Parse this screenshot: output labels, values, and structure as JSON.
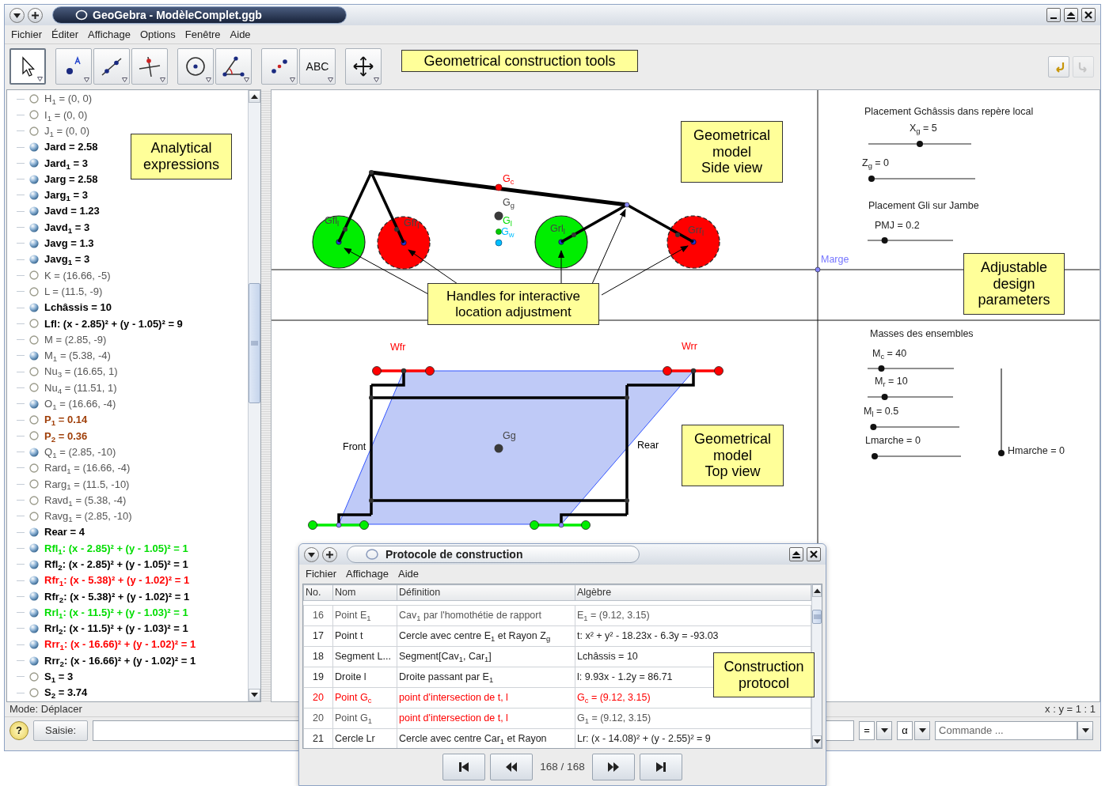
{
  "window": {
    "title": "GeoGebra - ModèleComplet.ggb"
  },
  "menu": [
    "Fichier",
    "Éditer",
    "Affichage",
    "Options",
    "Fenêtre",
    "Aide"
  ],
  "toolbar": {
    "groups": [
      [
        {
          "kind": "move",
          "selected": true
        }
      ],
      [
        {
          "kind": "point",
          "selected": false
        },
        {
          "kind": "line",
          "selected": false
        },
        {
          "kind": "perpendicular",
          "selected": false
        }
      ],
      [
        {
          "kind": "circle",
          "selected": false
        },
        {
          "kind": "angle",
          "selected": false
        }
      ],
      [
        {
          "kind": "reflect",
          "selected": false
        },
        {
          "kind": "text",
          "label": "ABC",
          "selected": false
        }
      ],
      [
        {
          "kind": "pan",
          "selected": false
        }
      ]
    ],
    "undo": {
      "disabled": false
    },
    "redo": {
      "disabled": true
    }
  },
  "annotations": [
    {
      "text": "Geometrical construction tools"
    },
    {
      "text": "Analytical\nexpressions"
    },
    {
      "text": "Geometrical\nmodel\nSide view"
    },
    {
      "text": "Handles for interactive\nlocation adjustment"
    },
    {
      "text": "Adjustable\ndesign\nparameters"
    },
    {
      "text": "Geometrical\nmodel\nTop view"
    },
    {
      "text": "Construction\nprotocol"
    }
  ],
  "algebra": {
    "rows": [
      {
        "text": "H$_{1}$ = (0, 0)",
        "shown": false,
        "bold": false,
        "color": "#555555"
      },
      {
        "text": "I$_{1}$ = (0, 0)",
        "shown": false,
        "bold": false,
        "color": "#555555"
      },
      {
        "text": "J$_{1}$ = (0, 0)",
        "shown": false,
        "bold": false,
        "color": "#555555"
      },
      {
        "text": "Jard = 2.58",
        "shown": true,
        "bold": true,
        "color": "#000000"
      },
      {
        "text": "Jard$_{1}$ = 3",
        "shown": true,
        "bold": true,
        "color": "#000000"
      },
      {
        "text": "Jarg = 2.58",
        "shown": true,
        "bold": true,
        "color": "#000000"
      },
      {
        "text": "Jarg$_{1}$ = 3",
        "shown": true,
        "bold": true,
        "color": "#000000"
      },
      {
        "text": "Javd = 1.23",
        "shown": true,
        "bold": true,
        "color": "#000000"
      },
      {
        "text": "Javd$_{1}$ = 3",
        "shown": true,
        "bold": true,
        "color": "#000000"
      },
      {
        "text": "Javg = 1.3",
        "shown": true,
        "bold": true,
        "color": "#000000"
      },
      {
        "text": "Javg$_{1}$ = 3",
        "shown": true,
        "bold": true,
        "color": "#000000"
      },
      {
        "text": "K = (16.66, -5)",
        "shown": false,
        "bold": false,
        "color": "#555555"
      },
      {
        "text": "L = (11.5, -9)",
        "shown": false,
        "bold": false,
        "color": "#555555"
      },
      {
        "text": "Lchâssis = 10",
        "shown": true,
        "bold": true,
        "color": "#000000"
      },
      {
        "text": "Lfl: (x - 2.85)² + (y - 1.05)² = 9",
        "shown": false,
        "bold": true,
        "color": "#000000"
      },
      {
        "text": "M = (2.85, -9)",
        "shown": false,
        "bold": false,
        "color": "#555555"
      },
      {
        "text": "M$_{1}$ = (5.38, -4)",
        "shown": true,
        "bold": false,
        "color": "#555555"
      },
      {
        "text": "Nu$_{3}$ = (16.65, 1)",
        "shown": false,
        "bold": false,
        "color": "#555555"
      },
      {
        "text": "Nu$_{4}$ = (11.51, 1)",
        "shown": false,
        "bold": false,
        "color": "#555555"
      },
      {
        "text": "O$_{1}$ = (16.66, -4)",
        "shown": true,
        "bold": false,
        "color": "#555555"
      },
      {
        "text": "P$_{1}$ = 0.14",
        "shown": false,
        "bold": true,
        "color": "#a0400a"
      },
      {
        "text": "P$_{2}$ = 0.36",
        "shown": false,
        "bold": true,
        "color": "#a0400a"
      },
      {
        "text": "Q$_{1}$ = (2.85, -10)",
        "shown": true,
        "bold": false,
        "color": "#555555"
      },
      {
        "text": "Rard$_{1}$ = (16.66, -4)",
        "shown": false,
        "bold": false,
        "color": "#555555"
      },
      {
        "text": "Rarg$_{1}$ = (11.5, -10)",
        "shown": false,
        "bold": false,
        "color": "#555555"
      },
      {
        "text": "Ravd$_{1}$ = (5.38, -4)",
        "shown": false,
        "bold": false,
        "color": "#555555"
      },
      {
        "text": "Ravg$_{1}$ = (2.85, -10)",
        "shown": false,
        "bold": false,
        "color": "#555555"
      },
      {
        "text": "Rear = 4",
        "shown": true,
        "bold": true,
        "color": "#000000"
      },
      {
        "text": "Rfl$_{1}$: (x - 2.85)² + (y - 1.05)² = 1",
        "shown": true,
        "bold": true,
        "color": "#00dd00"
      },
      {
        "text": "Rfl$_{2}$: (x - 2.85)² + (y - 1.05)² = 1",
        "shown": true,
        "bold": true,
        "color": "#000000"
      },
      {
        "text": "Rfr$_{1}$: (x - 5.38)² + (y - 1.02)² = 1",
        "shown": true,
        "bold": true,
        "color": "#ff0000"
      },
      {
        "text": "Rfr$_{2}$: (x - 5.38)² + (y - 1.02)² = 1",
        "shown": true,
        "bold": true,
        "color": "#000000"
      },
      {
        "text": "Rrl$_{1}$: (x - 11.5)² + (y - 1.03)² = 1",
        "shown": true,
        "bold": true,
        "color": "#00dd00"
      },
      {
        "text": "Rrl$_{2}$: (x - 11.5)² + (y - 1.03)² = 1",
        "shown": true,
        "bold": true,
        "color": "#000000"
      },
      {
        "text": "Rrr$_{1}$: (x - 16.66)² + (y - 1.02)² = 1",
        "shown": true,
        "bold": true,
        "color": "#ff0000"
      },
      {
        "text": "Rrr$_{2}$: (x - 16.66)² + (y - 1.02)² = 1",
        "shown": true,
        "bold": true,
        "color": "#000000"
      },
      {
        "text": "S$_{1}$ = 3",
        "shown": false,
        "bold": true,
        "color": "#000000"
      },
      {
        "text": "S$_{2}$ = 3.74",
        "shown": false,
        "bold": true,
        "color": "#000000"
      }
    ]
  },
  "graphics": {
    "labels": [
      {
        "text": "G$_{c}$",
        "color": "#ff0000"
      },
      {
        "text": "G$_{g}$",
        "color": "#444444"
      },
      {
        "text": "G$_{l}$",
        "color": "#00dd00"
      },
      {
        "text": "G$_{w}$",
        "color": "#00bfff"
      },
      {
        "text": "Gfl$_{l}$",
        "color": "#444444"
      },
      {
        "text": "Gfr$_{l}$",
        "color": "#444444"
      },
      {
        "text": "Grl$_{l}$",
        "color": "#444444"
      },
      {
        "text": "Grr$_{l}$",
        "color": "#444444"
      },
      {
        "text": "Marge",
        "color": "#7777ff"
      },
      {
        "text": "Wfr",
        "color": "#ff0000"
      },
      {
        "text": "Wrr",
        "color": "#ff0000"
      },
      {
        "text": "Front",
        "color": "#000000"
      },
      {
        "text": "Rear",
        "color": "#000000"
      },
      {
        "text": "Gg",
        "color": "#444444"
      }
    ],
    "headings": [
      "Placement Gchâssis dans repère local",
      "Placement Gli sur Jambe",
      "Masses des ensembles"
    ],
    "sliders": [
      {
        "label": "X$_{g}$ = 5",
        "level": 0.5,
        "kind": "horizontal"
      },
      {
        "label": "Z$_{g}$ = 0",
        "level": 0,
        "kind": "horizontal"
      },
      {
        "label": "PMJ = 0.2",
        "level": 0.2,
        "kind": "horizontal"
      },
      {
        "label": "M$_{c}$ = 40",
        "level": 0.16,
        "kind": "horizontal"
      },
      {
        "label": "M$_{r}$ = 10",
        "level": 0.2,
        "kind": "horizontal"
      },
      {
        "label": "M$_{l}$ = 0.5",
        "level": 0.03,
        "kind": "horizontal"
      },
      {
        "label": "Lmarche = 0",
        "level": 0,
        "kind": "horizontal"
      },
      {
        "label": "Hmarche = 0",
        "level": 0,
        "kind": "vertical"
      }
    ]
  },
  "status_bar": {
    "mode": "Mode: Déplacer",
    "ratio": "x : y = 1 : 1"
  },
  "input_bar": {
    "help": "?",
    "button": "Saisie:",
    "symbols": [
      "=",
      "α"
    ],
    "command": {
      "placeholder": "Commande ..."
    }
  },
  "protocol": {
    "title": "Protocole de construction",
    "menu": [
      "Fichier",
      "Affichage",
      "Aide"
    ],
    "columns": [
      "No.",
      "Nom",
      "Définition",
      "Algèbre"
    ],
    "rows": [
      {
        "cells": [
          {
            "text": "16",
            "color": "#555555"
          },
          {
            "text": "Point E$_{1}$",
            "color": "#555555"
          },
          {
            "text": "Cav$_{1}$ par l'homothétie de rapport",
            "color": "#555555"
          },
          {
            "text": "E$_{1}$ = (9.12, 3.15)",
            "color": "#555555"
          }
        ]
      },
      {
        "cells": [
          {
            "text": "17",
            "color": "#222222"
          },
          {
            "text": "Point t",
            "color": "#222222"
          },
          {
            "text": "Cercle avec centre E$_{1}$ et Rayon Z$_{g}$",
            "color": "#222222"
          },
          {
            "text": "t: x² + y² - 18.23x - 6.3y = -93.03",
            "color": "#222222"
          }
        ]
      },
      {
        "cells": [
          {
            "text": "18",
            "color": "#222222"
          },
          {
            "text": "Segment L...",
            "color": "#222222"
          },
          {
            "text": "Segment[Cav$_{1}$, Car$_{1}$]",
            "color": "#222222"
          },
          {
            "text": "Lchâssis = 10",
            "color": "#222222"
          }
        ]
      },
      {
        "cells": [
          {
            "text": "19",
            "color": "#222222"
          },
          {
            "text": "Droite l",
            "color": "#222222"
          },
          {
            "text": "Droite passant par E$_{1}$",
            "color": "#222222"
          },
          {
            "text": "l: 9.93x - 1.2y = 86.71",
            "color": "#222222"
          }
        ]
      },
      {
        "cells": [
          {
            "text": "20",
            "color": "#ff0000"
          },
          {
            "text": "Point G$_{c}$",
            "color": "#ff0000"
          },
          {
            "text": "point d'intersection de t, l",
            "color": "#ff0000"
          },
          {
            "text": "G$_{c}$ = (9.12, 3.15)",
            "color": "#ff0000"
          }
        ]
      },
      {
        "cells": [
          {
            "text": "20",
            "color": "#555555"
          },
          {
            "text": "Point G$_{1}$",
            "color": "#555555"
          },
          {
            "text": "point d'intersection de t, l",
            "color": "#ff0000"
          },
          {
            "text": "G$_{1}$ = (9.12, 3.15)",
            "color": "#555555"
          }
        ]
      },
      {
        "cells": [
          {
            "text": "21",
            "color": "#222222"
          },
          {
            "text": "Cercle Lr",
            "color": "#222222"
          },
          {
            "text": "Cercle avec centre Car$_{1}$ et Rayon",
            "color": "#222222"
          },
          {
            "text": "Lr: (x - 14.08)² + (y - 2.55)² = 9",
            "color": "#222222"
          }
        ]
      }
    ],
    "position": "168 / 168"
  }
}
